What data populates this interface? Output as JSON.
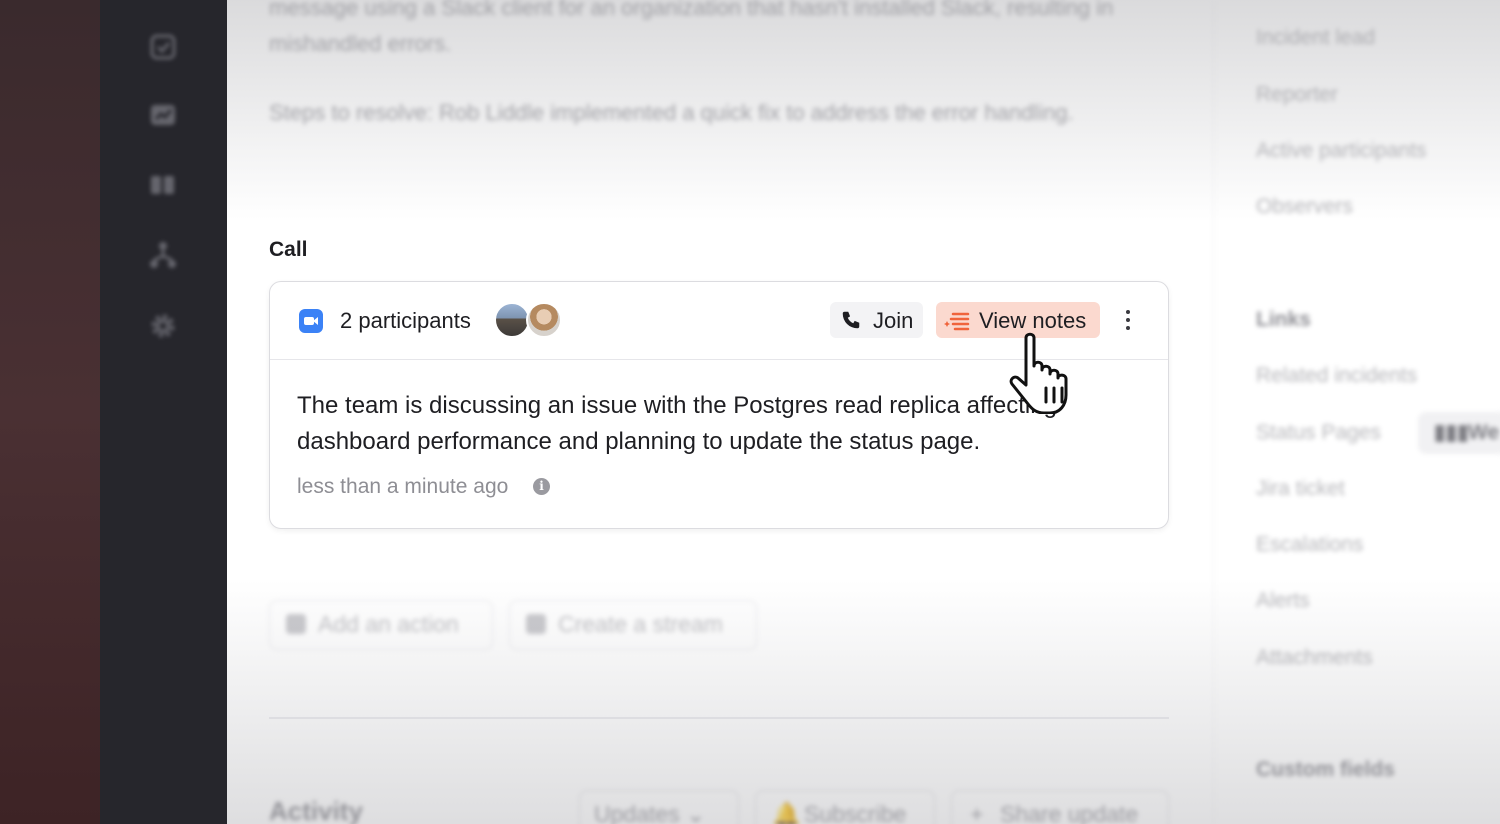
{
  "description": {
    "line1": "message using a Slack client for an organization that hasn't installed Slack, resulting in mishandled errors.",
    "line2": "Steps to resolve: Rob Liddle implemented a quick fix to address the error handling."
  },
  "call": {
    "heading": "Call",
    "participants_label": "2 participants",
    "join_label": "Join",
    "view_notes_label": "View notes",
    "summary": "The team is discussing an issue with the Postgres read replica affecting dashboard performance and planning to update the status page.",
    "timestamp": "less than a minute ago"
  },
  "actions": {
    "add_action": "Add an action",
    "create_stream": "Create a stream"
  },
  "activity": {
    "heading": "Activity",
    "updates_label": "Updates",
    "subscribe_label": "Subscribe",
    "share_update_label": "Share update"
  },
  "right_panel": {
    "roles": [
      "Incident lead",
      "Reporter",
      "Active participants",
      "Observers"
    ],
    "links_heading": "Links",
    "links": [
      "Related incidents",
      "Status Pages",
      "Jira ticket",
      "Escalations",
      "Alerts",
      "Attachments"
    ],
    "status_chip": "We",
    "custom_fields_heading": "Custom fields"
  },
  "colors": {
    "sidebar": "#26262c",
    "view_notes_bg": "#fbd9cf",
    "notes_icon": "#f0643c",
    "zoom_blue": "#3b82f6"
  }
}
